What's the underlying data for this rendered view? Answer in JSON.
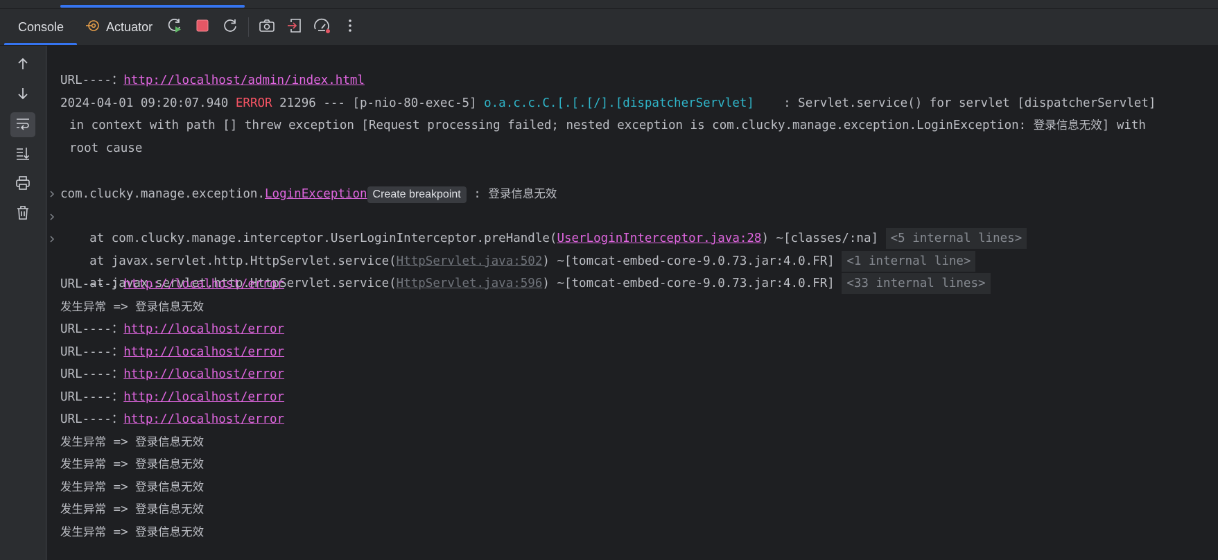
{
  "toolbar": {
    "tabs": [
      {
        "label": "Console",
        "icon": "none",
        "active": true
      },
      {
        "label": "Actuator",
        "icon": "actuator-icon",
        "active": false
      }
    ],
    "buttons": [
      "rerun-icon",
      "stop-icon",
      "restart-icon",
      "camera-icon",
      "exit-icon",
      "speedometer-icon",
      "more-icon"
    ]
  },
  "sidebar": {
    "buttons": [
      "arrow-up-icon",
      "arrow-down-icon",
      "soft-wrap-icon",
      "scroll-to-end-icon",
      "print-icon",
      "trash-icon"
    ],
    "active": "soft-wrap-icon"
  },
  "colors": {
    "link": "#e066e0",
    "error": "#f75464",
    "logger": "#2fb5c9",
    "accent": "#3574f0",
    "stop": "#e55765"
  },
  "console": {
    "l1_prefix": "URL----：",
    "l1_link": "http://localhost/admin/index.html",
    "l2_ts": "2024-04-01 09:20:07.940 ",
    "l2_level": "ERROR",
    "l2_pid": " 21296 --- [p-nio-80-exec-5] ",
    "l2_logger": "o.a.c.c.C.[.[.[/].[dispatcherServlet]",
    "l2_msg": "    : Servlet.service() for servlet [dispatcherServlet]",
    "l3_text": "in context with path [] threw exception [Request processing failed; nested exception is com.clucky.manage.exception.LoginException: ",
    "l3_cn": "登录信息无效",
    "l3_end": "] with",
    "l4_text": "root cause",
    "l5_prefix": "com.clucky.manage.exception.",
    "l5_link": "LoginException",
    "l5_chip": "Create breakpoint",
    "l5_colon": " : ",
    "l5_cn": "登录信息无效",
    "l6_text": "    at com.clucky.manage.interceptor.UserLoginInterceptor.preHandle(",
    "l6_link": "UserLoginInterceptor.java:28",
    "l6_end": ") ~[classes/:na]",
    "l6_fold": "<5 internal lines>",
    "l7_text": "    at javax.servlet.http.HttpServlet.service(",
    "l7_link": "HttpServlet.java:502",
    "l7_end": ") ~[tomcat-embed-core-9.0.73.jar:4.0.FR]",
    "l7_fold": "<1 internal line>",
    "l8_text": "    at javax.servlet.http.HttpServlet.service(",
    "l8_link": "HttpServlet.java:596",
    "l8_end": ") ~[tomcat-embed-core-9.0.73.jar:4.0.FR]",
    "l8_fold": "<33 internal lines>",
    "url_prefix": "URL----：",
    "url_error": "http://localhost/error",
    "exc_cn": "发生异常",
    "exc_arrow": " => ",
    "exc_msg": "登录信息无效"
  }
}
